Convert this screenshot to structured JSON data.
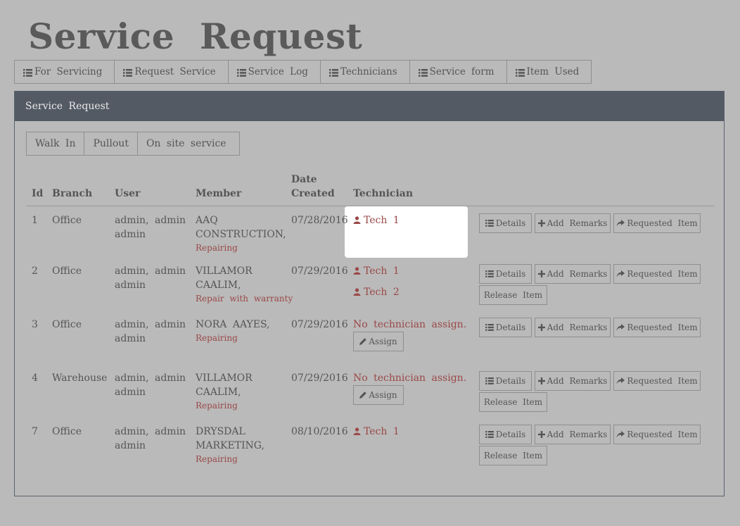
{
  "page": {
    "title": "Service Request"
  },
  "nav": {
    "items": [
      "For Servicing",
      "Request Service",
      "Service Log",
      "Technicians",
      "Service form",
      "Item Used"
    ]
  },
  "panel": {
    "heading": "Service Request",
    "tabs": [
      "Walk In",
      "Pullout",
      "On site service"
    ],
    "columns": {
      "id": "Id",
      "branch": "Branch",
      "user": "User",
      "member": "Member",
      "date_line1": "Date",
      "date_line2": "Created",
      "technician": "Technician"
    },
    "buttons": {
      "details": "Details",
      "add_remarks": "Add Remarks",
      "requested_item": "Requested Item",
      "release_item": "Release Item",
      "assign": "Assign"
    },
    "no_tech_text": "No technician assign.",
    "rows": [
      {
        "id": "1",
        "branch": "Office",
        "user_line1": "admin, admin",
        "user_line2": "admin",
        "member_line1": "AAQ",
        "member_line2": "CONSTRUCTION,",
        "status": "Repairing",
        "date": "07/28/2016",
        "techs": [
          "Tech 1"
        ]
      },
      {
        "id": "2",
        "branch": "Office",
        "user_line1": "admin, admin",
        "user_line2": "admin",
        "member_line1": "VILLAMOR",
        "member_line2": "CAALIM,",
        "status": "Repair with warranty",
        "date": "07/29/2016",
        "techs": [
          "Tech 1",
          "Tech 2"
        ]
      },
      {
        "id": "3",
        "branch": "Office",
        "user_line1": "admin, admin",
        "user_line2": "admin",
        "member_line1": "NORA AAYES,",
        "member_line2": "",
        "status": "Repairing",
        "date": "07/29/2016",
        "techs": []
      },
      {
        "id": "4",
        "branch": "Warehouse",
        "user_line1": "admin, admin",
        "user_line2": "admin",
        "member_line1": "VILLAMOR",
        "member_line2": "CAALIM,",
        "status": "Repairing",
        "date": "07/29/2016",
        "techs": []
      },
      {
        "id": "7",
        "branch": "Office",
        "user_line1": "admin, admin",
        "user_line2": "admin",
        "member_line1": "DRYSDAL",
        "member_line2": "MARKETING,",
        "status": "Repairing",
        "date": "08/10/2016",
        "techs": [
          "Tech 1"
        ]
      }
    ]
  }
}
